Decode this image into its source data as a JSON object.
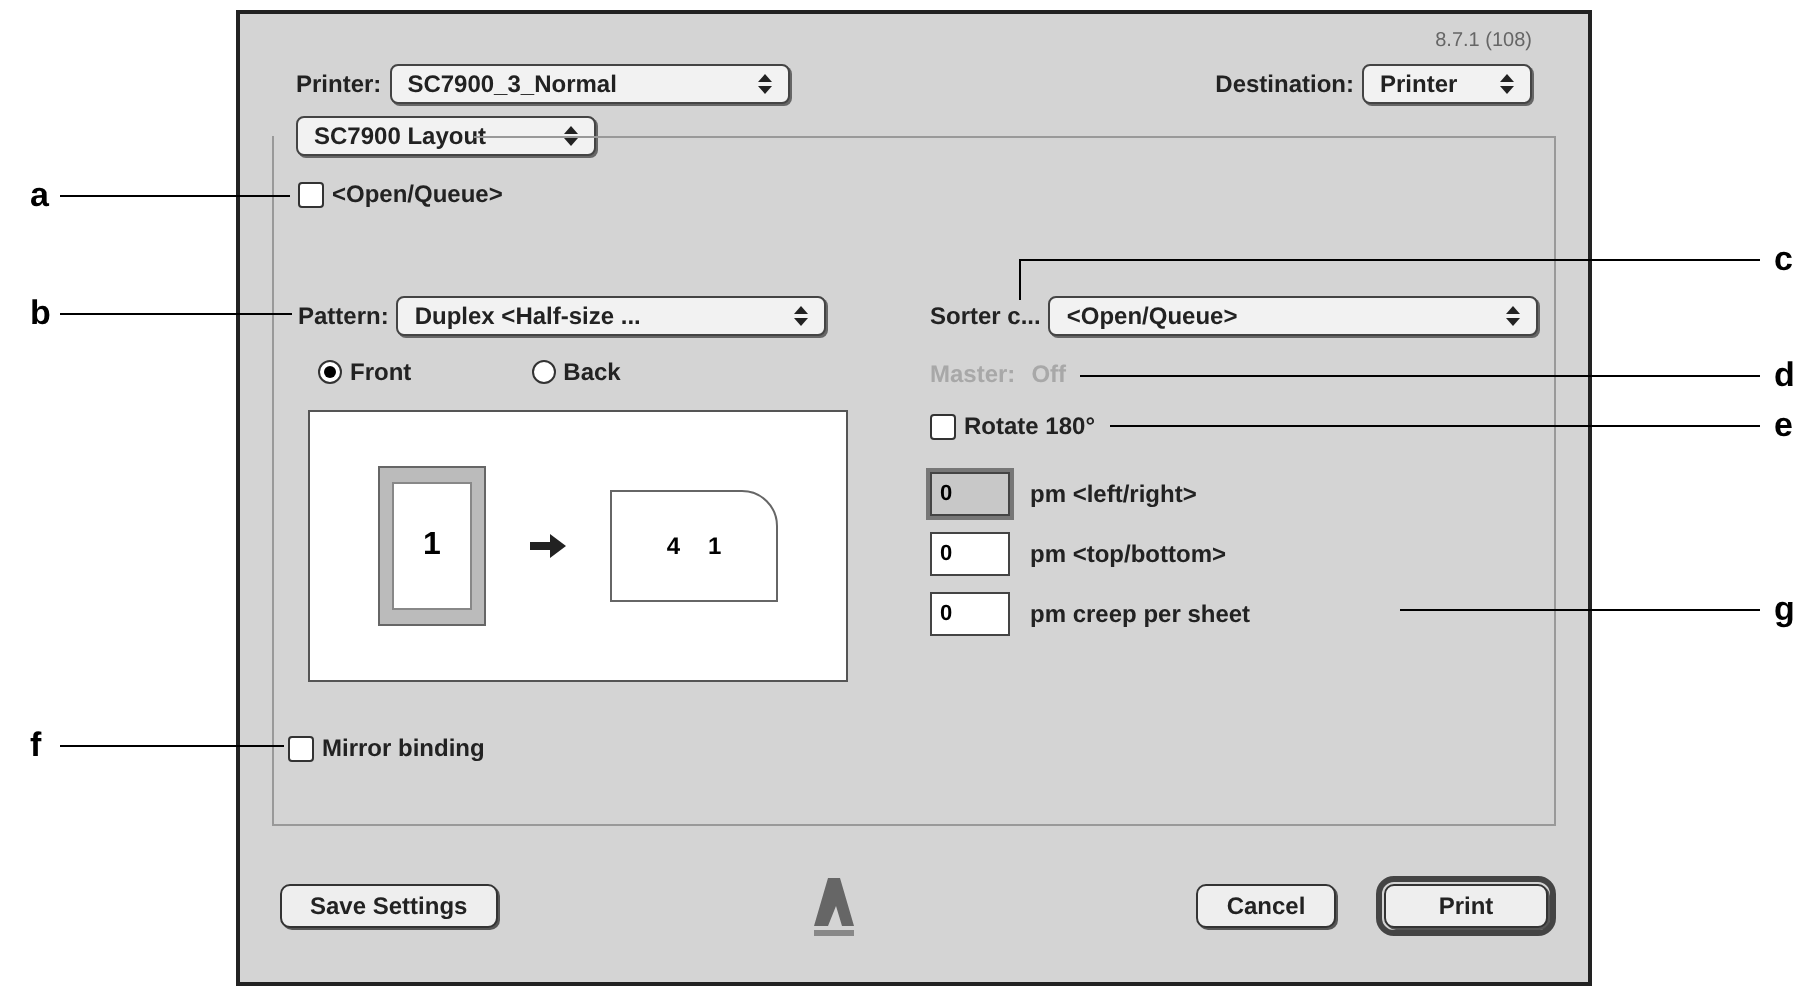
{
  "version": "8.7.1 (108)",
  "printer": {
    "label": "Printer:",
    "value": "SC7900_3_Normal"
  },
  "destination": {
    "label": "Destination:",
    "value": "Printer"
  },
  "panel_menu": {
    "value": "SC7900 Layout"
  },
  "open_queue": {
    "label": "<Open/Queue>",
    "checked": false
  },
  "pattern": {
    "label": "Pattern:",
    "value": "Duplex <Half-size ..."
  },
  "sides": [
    {
      "label": "Front",
      "selected": true
    },
    {
      "label": "Back",
      "selected": false
    }
  ],
  "preview": {
    "front_page": "1",
    "spread": [
      "4",
      "1"
    ]
  },
  "sorter": {
    "label": "Sorter c...",
    "value": "<Open/Queue>"
  },
  "master": {
    "label": "Master:",
    "value": "Off",
    "disabled": true
  },
  "rotate": {
    "label": "Rotate 180°",
    "checked": false
  },
  "offsets": [
    {
      "value": "0",
      "label": "pm <left/right>",
      "selected": true
    },
    {
      "value": "0",
      "label": "pm <top/bottom>",
      "selected": false
    },
    {
      "value": "0",
      "label": "pm creep per sheet",
      "selected": false
    }
  ],
  "mirror_binding": {
    "label": "Mirror binding",
    "checked": false
  },
  "buttons": [
    {
      "label": "Save Settings",
      "default": false
    },
    {
      "label": "Cancel",
      "default": false
    },
    {
      "label": "Print",
      "default": true
    }
  ],
  "callouts": [
    "a",
    "b",
    "c",
    "d",
    "e",
    "f",
    "g"
  ]
}
